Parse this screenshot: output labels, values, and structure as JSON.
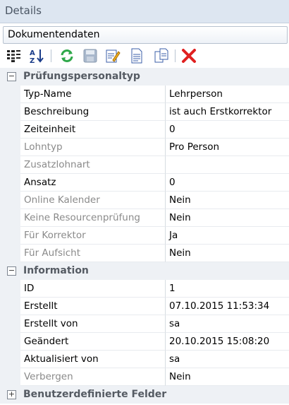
{
  "window": {
    "title": "Details"
  },
  "selector": {
    "value": "Dokumentendaten"
  },
  "toolbar": {
    "icons": [
      "categorized-view-icon",
      "sort-alphabetical-icon",
      "refresh-icon",
      "save-icon",
      "edit-icon",
      "document-icon",
      "copy-icon",
      "delete-icon"
    ]
  },
  "categories": [
    {
      "label": "Prüfungspersonaltyp",
      "expanded": true,
      "rows": [
        {
          "name": "Typ-Name",
          "value": "Lehrperson",
          "readonly": false
        },
        {
          "name": "Beschreibung",
          "value": "ist auch Erstkorrektor",
          "readonly": false
        },
        {
          "name": "Zeiteinheit",
          "value": "0",
          "readonly": false
        },
        {
          "name": "Lohntyp",
          "value": "Pro Person",
          "readonly": true
        },
        {
          "name": "Zusatzlohnart",
          "value": "",
          "readonly": true
        },
        {
          "name": "Ansatz",
          "value": "0",
          "readonly": false
        },
        {
          "name": "Online Kalender",
          "value": "Nein",
          "readonly": true
        },
        {
          "name": "Keine Resourcenprüfung",
          "value": "Nein",
          "readonly": true
        },
        {
          "name": "Für Korrektor",
          "value": "Ja",
          "readonly": true
        },
        {
          "name": "Für Aufsicht",
          "value": "Nein",
          "readonly": true
        }
      ]
    },
    {
      "label": "Information",
      "expanded": true,
      "rows": [
        {
          "name": "ID",
          "value": "1",
          "readonly": false
        },
        {
          "name": "Erstellt",
          "value": "07.10.2015 11:53:34",
          "readonly": false
        },
        {
          "name": "Erstellt von",
          "value": "sa",
          "readonly": false
        },
        {
          "name": "Geändert",
          "value": "20.10.2015 15:08:20",
          "readonly": false
        },
        {
          "name": "Aktualisiert von",
          "value": "sa",
          "readonly": false
        },
        {
          "name": "Verbergen",
          "value": "Nein",
          "readonly": true
        }
      ]
    },
    {
      "label": "Benutzerdefinierte Felder",
      "expanded": false,
      "rows": []
    }
  ],
  "expander": {
    "expanded_glyph": "−",
    "collapsed_glyph": "+"
  },
  "colors": {
    "header_bg": "#dde6f1",
    "gutter_bg": "#eef1f5",
    "readonly_text": "#8a8a8a"
  }
}
